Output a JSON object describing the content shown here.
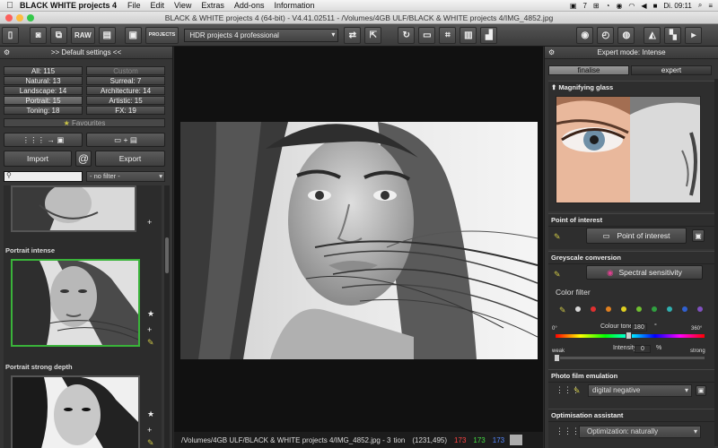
{
  "menubar": {
    "app_name": "BLACK WHITE projects 4",
    "items": [
      "File",
      "Edit",
      "View",
      "Extras",
      "Add-ons",
      "Information"
    ],
    "clock": "Di. 09:11",
    "status_num": "7"
  },
  "window": {
    "title": "BLACK & WHITE projects 4 (64-bit) - V4.41.02511 - /Volumes/4GB ULF/BLACK & WHITE projects 4/IMG_4852.jpg"
  },
  "toolbar": {
    "raw_label": "RAW",
    "projects_label": "PROJECTS",
    "hdr_select": "HDR projects 4 professional"
  },
  "left_panel": {
    "header": ">> Default settings <<",
    "categories": [
      {
        "label": "All: 115"
      },
      {
        "label": "Custom"
      },
      {
        "label": "Natural: 13"
      },
      {
        "label": "Surreal: 7"
      },
      {
        "label": "Landscape: 14"
      },
      {
        "label": "Architecture: 14"
      },
      {
        "label": "Portrait: 15"
      },
      {
        "label": "Artistic: 15"
      },
      {
        "label": "Toning: 18"
      },
      {
        "label": "FX: 19"
      }
    ],
    "favourites": "Favourites",
    "import_label": "Import",
    "export_label": "Export",
    "filter": "- no filter -",
    "presets": [
      {
        "label": "Portrait intense"
      },
      {
        "label": "Portrait strong depth"
      }
    ]
  },
  "right_panel": {
    "header": "Expert mode: Intense",
    "tabs": [
      "finalise",
      "expert"
    ],
    "magnifier_label": "Magnifying glass",
    "poi_title": "Point of interest",
    "poi_button": "Point of interest",
    "greyscale_title": "Greyscale conversion",
    "spectral_button": "Spectral sensitivity",
    "color_filter_label": "Color filter",
    "color_dots": [
      "#d8d8d8",
      "#e03030",
      "#e08020",
      "#e0d020",
      "#70c030",
      "#30a040",
      "#30b0b0",
      "#3060d0",
      "#8050c0"
    ],
    "colour_tone_label": "Colour tone",
    "colour_tone_value": "180",
    "colour_tone_unit": "°",
    "hue_min": "0°",
    "hue_max": "360°",
    "intensity_label": "Intensity",
    "intensity_value": "0",
    "intensity_unit": "%",
    "weak_label": "weak",
    "strong_label": "strong",
    "film_title": "Photo film emulation",
    "film_select": "digital negative",
    "opt_title": "Optimisation assistant",
    "opt_select": "Optimization: naturally"
  },
  "status": {
    "path": "/Volumes/4GB ULF/BLACK & WHITE projects 4/IMG_4852.jpg - 3",
    "position_label": "tion",
    "coords": "(1231,495)",
    "r": "173",
    "g": "173",
    "b": "173"
  }
}
